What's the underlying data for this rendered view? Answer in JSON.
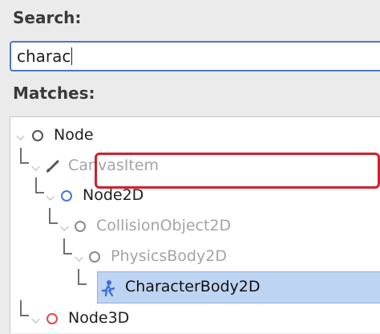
{
  "search": {
    "label": "Search:",
    "value": "charac"
  },
  "matches": {
    "label": "Matches:"
  },
  "tree": {
    "items": [
      {
        "label": "Node",
        "icon": "node-icon",
        "state": "normal"
      },
      {
        "label": "CanvasItem",
        "icon": "brush-icon",
        "state": "dimmed"
      },
      {
        "label": "Node2D",
        "icon": "node2d-icon",
        "state": "normal"
      },
      {
        "label": "CollisionObject2D",
        "icon": "collision-object-icon",
        "state": "dimmed"
      },
      {
        "label": "PhysicsBody2D",
        "icon": "physics-body-icon",
        "state": "dimmed"
      },
      {
        "label": "CharacterBody2D",
        "icon": "character-body-icon",
        "state": "selected"
      },
      {
        "label": "Node3D",
        "icon": "node3d-icon",
        "state": "normal"
      }
    ]
  },
  "colors": {
    "accent": "#4a78c4",
    "selection": "#bed4f3",
    "highlight": "#d41f2d",
    "node3d": "#e04c4c"
  }
}
